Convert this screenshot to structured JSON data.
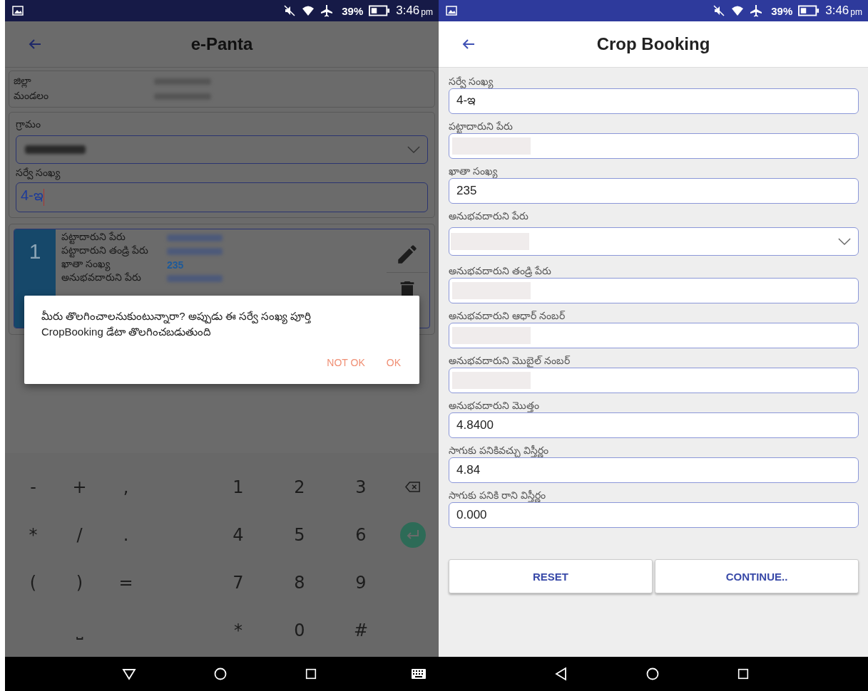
{
  "left_screen": {
    "status_bar": {
      "battery": "39%",
      "time": "3:46",
      "time_suffix": "pm"
    },
    "app_bar": {
      "title": "e-Panta"
    },
    "location_card": {
      "rows": [
        {
          "label": "జిల్లా",
          "kind": "blurred"
        },
        {
          "label": "మండలం",
          "kind": "blurred"
        }
      ]
    },
    "village": {
      "label": "గ్రామం",
      "kind": "blurred"
    },
    "survey": {
      "label": "సర్వే సంఖ్య",
      "value": "4-ఇ"
    },
    "record_card": {
      "number": "1",
      "rows": [
        {
          "label": "పట్టాదారుని పేరు",
          "kind": "blurred"
        },
        {
          "label": "పట్టాదారుని తండ్రి పేరు",
          "kind": "blurred"
        },
        {
          "label": "ఖాతా సంఖ్య",
          "kind": "text",
          "value": "235"
        },
        {
          "label": "అనుభవదారుని పేరు",
          "kind": "blurred"
        }
      ]
    },
    "dialog": {
      "message": "మీరు తొలగించాలనుకుంటున్నారా? అప్పుడు ఈ సర్వే సంఖ్య పూర్తి CropBooking డేటా తొలగించబడుతుంది",
      "buttons": [
        "NOT OK",
        "OK"
      ]
    },
    "keyboard": {
      "rows": [
        [
          {
            "kind": "key",
            "label": "-"
          },
          {
            "kind": "key",
            "label": "+"
          },
          {
            "kind": "key",
            "label": ","
          },
          {
            "kind": "key",
            "label": "1"
          },
          {
            "kind": "key",
            "label": "2"
          },
          {
            "kind": "key",
            "label": "3"
          },
          {
            "kind": "backspace"
          }
        ],
        [
          {
            "kind": "key",
            "label": "*"
          },
          {
            "kind": "key",
            "label": "/"
          },
          {
            "kind": "key",
            "label": "."
          },
          {
            "kind": "key",
            "label": "4"
          },
          {
            "kind": "key",
            "label": "5"
          },
          {
            "kind": "key",
            "label": "6"
          },
          {
            "kind": "enter"
          }
        ],
        [
          {
            "kind": "key",
            "label": "("
          },
          {
            "kind": "key",
            "label": ")"
          },
          {
            "kind": "key",
            "label": "="
          },
          {
            "kind": "key",
            "label": "7"
          },
          {
            "kind": "key",
            "label": "8"
          },
          {
            "kind": "key",
            "label": "9"
          },
          {
            "kind": "gap"
          }
        ],
        [
          {
            "kind": "gap"
          },
          {
            "kind": "key",
            "label": "⎵"
          },
          {
            "kind": "gap"
          },
          {
            "kind": "key",
            "label": "*"
          },
          {
            "kind": "key",
            "label": "0"
          },
          {
            "kind": "key",
            "label": "#"
          },
          {
            "kind": "gap"
          }
        ]
      ]
    },
    "nav_bar": {
      "keyboard_switch": true
    }
  },
  "right_screen": {
    "status_bar": {
      "battery": "39%",
      "time": "3:46",
      "time_suffix": "pm"
    },
    "app_bar": {
      "title": "Crop Booking"
    },
    "fields": [
      {
        "label": "సర్వే సంఖ్య",
        "kind": "text",
        "value": "4-ఇ"
      },
      {
        "label": "పట్టాదారుని పేరు",
        "kind": "redacted"
      },
      {
        "label": "ఖాతా సంఖ్య",
        "kind": "text",
        "value": "235"
      },
      {
        "label": "అనుభవదారుని పేరు",
        "kind": "dropdown"
      },
      {
        "label": "అనుభవదారుని తండ్రి పేరు",
        "kind": "redacted"
      },
      {
        "label": "అనుభవదారుని ఆధార్ నంబర్",
        "kind": "redacted"
      },
      {
        "label": "అనుభవదారుని మొబైల్ నంబర్",
        "kind": "redacted"
      },
      {
        "label": "అనుభవదారుని మొత్తం",
        "kind": "text",
        "value": "4.8400"
      },
      {
        "label": "సాగుకు పనికివచ్చు విస్తీర్ణం",
        "kind": "text",
        "value": "4.84"
      },
      {
        "label": "సాగుకు పనికి రాని విస్తీర్ణం",
        "kind": "text",
        "value": "0.000"
      }
    ],
    "buttons": [
      "RESET",
      "CONTINUE.."
    ],
    "nav_bar": {
      "keyboard_switch": false
    }
  }
}
